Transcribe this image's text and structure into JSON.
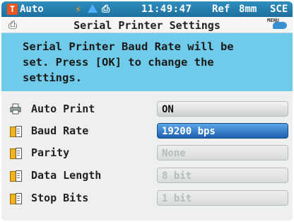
{
  "statusbar": {
    "mode": "Auto",
    "time": "11:49:47",
    "ref": "Ref",
    "measure_area": "8mm",
    "sce": "SCE"
  },
  "header": {
    "title": "Serial Printer Settings",
    "menu_badge": "MENU"
  },
  "message": {
    "text": "Serial Printer Baud Rate will be\nset. Press [OK] to change the\nsettings."
  },
  "settings": [
    {
      "label": "Auto Print",
      "value": "ON",
      "icon": "printer-icon",
      "state": "normal"
    },
    {
      "label": "Baud Rate",
      "value": "19200 bps",
      "icon": "book-icon",
      "state": "selected"
    },
    {
      "label": "Parity",
      "value": "None",
      "icon": "book-icon",
      "state": "disabled"
    },
    {
      "label": "Data Length",
      "value": "8 bit",
      "icon": "book-icon",
      "state": "disabled"
    },
    {
      "label": "Stop Bits",
      "value": "1 bit",
      "icon": "book-icon",
      "state": "disabled"
    }
  ],
  "colors": {
    "statusbar": "#1e6f9f",
    "message_bg": "#6fcbe9",
    "selected": "#1e5fb0"
  }
}
